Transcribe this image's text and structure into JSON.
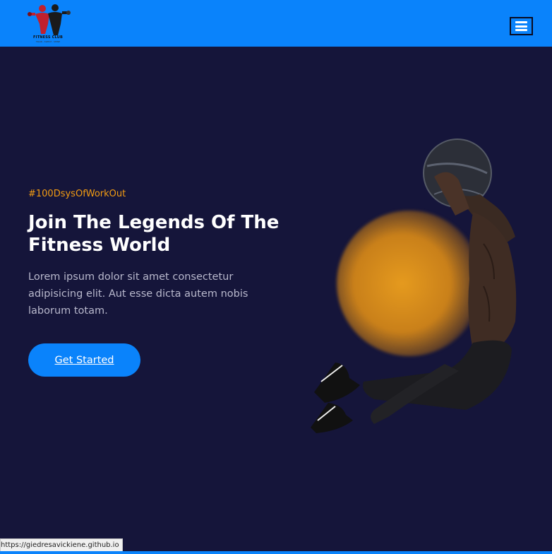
{
  "brand": {
    "logo_text": "FITNESS CLUB",
    "logo_sub": "TRAIN . SWEAT . SHINE"
  },
  "nav": {
    "menu_icon": "hamburger-icon"
  },
  "hero": {
    "tag": "#100DsysOfWorkOut",
    "title": "Join The Legends Of The Fitness World",
    "text": "Lorem ipsum dolor sit amet consectetur adipisicing elit. Aut esse dicta autem nobis laborum totam.",
    "cta_label": "Get Started"
  },
  "status": {
    "url": "https://giedresavickiene.github.io"
  },
  "colors": {
    "navbar": "#0a83fb",
    "background": "#15153a",
    "accent": "#f39c12"
  }
}
